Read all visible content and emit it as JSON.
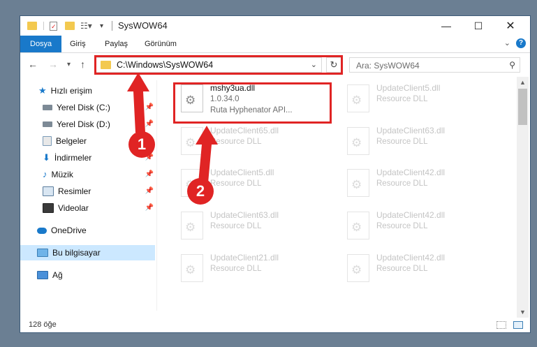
{
  "window": {
    "title": "SysWOW64"
  },
  "ribbon": {
    "tabs": [
      "Dosya",
      "Giriş",
      "Paylaş",
      "Görünüm"
    ]
  },
  "address": {
    "path": "C:\\Windows\\SysWOW64"
  },
  "search": {
    "placeholder": "Ara: SysWOW64"
  },
  "sidebar": {
    "items": [
      {
        "label": "Hızlı erişim",
        "icon": "star-icon"
      },
      {
        "label": "Yerel Disk (C:)",
        "icon": "drive-icon",
        "pinned": true
      },
      {
        "label": "Yerel Disk (D:)",
        "icon": "drive-icon",
        "pinned": true
      },
      {
        "label": "Belgeler",
        "icon": "documents-icon",
        "pinned": true
      },
      {
        "label": "İndirmeler",
        "icon": "download-icon",
        "pinned": true
      },
      {
        "label": "Müzik",
        "icon": "music-icon",
        "pinned": true
      },
      {
        "label": "Resimler",
        "icon": "pictures-icon",
        "pinned": true
      },
      {
        "label": "Videolar",
        "icon": "videos-icon",
        "pinned": true
      },
      {
        "label": "OneDrive",
        "icon": "cloud-icon"
      },
      {
        "label": "Bu bilgisayar",
        "icon": "computer-icon",
        "selected": true
      },
      {
        "label": "Ağ",
        "icon": "network-icon"
      }
    ]
  },
  "files": {
    "highlighted": {
      "name": "mshy3ua.dll",
      "version": "1.0.34.0",
      "description": "Ruta Hyphenator API..."
    },
    "left_column": [
      {
        "name": "UpdateClient65.dll",
        "type": "Resource DLL"
      },
      {
        "name": "UpdateClient5.dll",
        "type": "Resource DLL"
      },
      {
        "name": "UpdateClient63.dll",
        "type": "Resource DLL"
      },
      {
        "name": "UpdateClient21.dll",
        "type": "Resource DLL"
      }
    ],
    "right_column": [
      {
        "name": "UpdateClient5.dll",
        "type": "Resource DLL"
      },
      {
        "name": "UpdateClient63.dll",
        "type": "Resource DLL"
      },
      {
        "name": "UpdateClient42.dll",
        "type": "Resource DLL"
      },
      {
        "name": "UpdateClient42.dll",
        "type": "Resource DLL"
      },
      {
        "name": "UpdateClient42.dll",
        "type": "Resource DLL"
      }
    ]
  },
  "status": {
    "item_count": "128 öğe"
  },
  "annotations": {
    "step1": "1",
    "step2": "2"
  },
  "colors": {
    "accent": "#1979ca",
    "highlight": "#e02424",
    "selection": "#cce8ff"
  }
}
